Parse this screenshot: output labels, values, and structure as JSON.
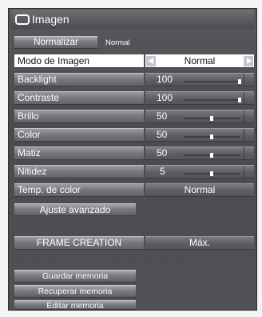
{
  "menu": {
    "title": "Imagen",
    "icon": "screen-icon"
  },
  "normalize": {
    "button_label": "Normalizar",
    "status": "Normal"
  },
  "rows": [
    {
      "label": "Modo de Imagen",
      "value": "Normal",
      "selected": true
    },
    {
      "label": "Backlight",
      "value": "100",
      "level": 100
    },
    {
      "label": "Contraste",
      "value": "100",
      "level": 100
    },
    {
      "label": "Brillo",
      "value": "50",
      "level": 50
    },
    {
      "label": "Color",
      "value": "50",
      "level": 50
    },
    {
      "label": "Matiz",
      "value": "50",
      "level": 50
    },
    {
      "label": "Nitidez",
      "value": "5",
      "level": 50
    },
    {
      "label": "Temp. de color",
      "value": "Normal"
    }
  ],
  "advanced": {
    "label": "Ajuste avanzado"
  },
  "frame_creation": {
    "label": "FRAME CREATION",
    "value": "Máx."
  },
  "memory": {
    "save": "Guardar memoria",
    "load": "Recuperar memoria",
    "edit": "Editar memoria"
  },
  "colors": {
    "panel": "#505155",
    "highlight": "#ffffff",
    "button": "#8a8b8f",
    "page": "#f4f4f4"
  }
}
